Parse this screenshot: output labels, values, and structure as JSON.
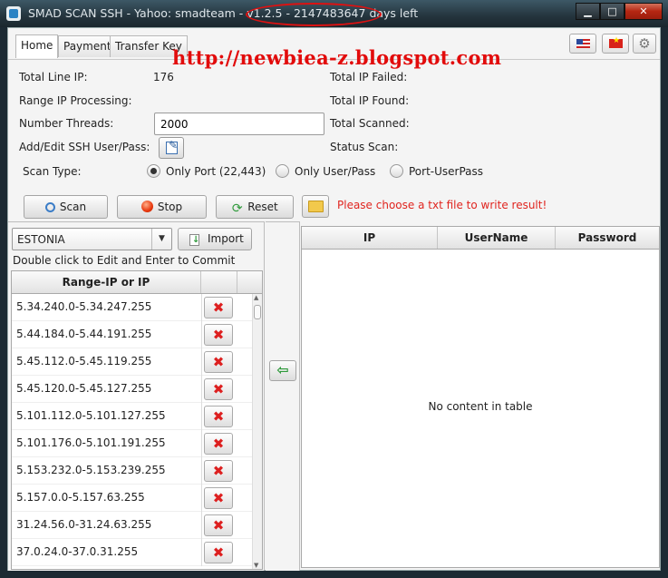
{
  "window": {
    "title": "SMAD SCAN SSH - Yahoo: smadteam - v1.2.5 - 2147483647 days left",
    "minimize_glyph": "▁",
    "maximize_glyph": "□",
    "close_glyph": "✕"
  },
  "tabs": [
    "Home",
    "Payment",
    "Transfer Key"
  ],
  "watermark": "http://newbiea-z.blogspot.com",
  "stats": {
    "total_line_ip_label": "Total Line IP:",
    "total_line_ip_value": "176",
    "range_ip_processing_label": "Range IP Processing:",
    "number_threads_label": "Number Threads:",
    "number_threads_value": "2000",
    "add_edit_label": "Add/Edit SSH User/Pass:",
    "total_ip_failed_label": "Total IP Failed:",
    "total_ip_found_label": "Total IP Found:",
    "total_scanned_label": "Total Scanned:",
    "status_scan_label": "Status Scan:"
  },
  "scan_type": {
    "label": "Scan Type:",
    "options": [
      "Only Port (22,443)",
      "Only User/Pass",
      "Port-UserPass"
    ],
    "selected": "Only Port (22,443)"
  },
  "actions": {
    "scan": "Scan",
    "stop": "Stop",
    "reset": "Reset",
    "hint": "Please choose a txt file to write result!"
  },
  "left": {
    "country": "ESTONIA",
    "arrow": "▼",
    "import": "Import",
    "hint": "Double click to Edit and Enter to Commit",
    "column": "Range-IP or IP",
    "delete_glyph": "✖",
    "ranges": [
      "5.34.240.0-5.34.247.255",
      "5.44.184.0-5.44.191.255",
      "5.45.112.0-5.45.119.255",
      "5.45.120.0-5.45.127.255",
      "5.101.112.0-5.101.127.255",
      "5.101.176.0-5.101.191.255",
      "5.153.232.0-5.153.239.255",
      "5.157.0.0-5.157.63.255",
      "31.24.56.0-31.24.63.255",
      "37.0.24.0-37.0.31.255"
    ]
  },
  "move_glyph": "⇦",
  "results": {
    "columns": [
      "IP",
      "UserName",
      "Password"
    ],
    "empty": "No content in table"
  }
}
